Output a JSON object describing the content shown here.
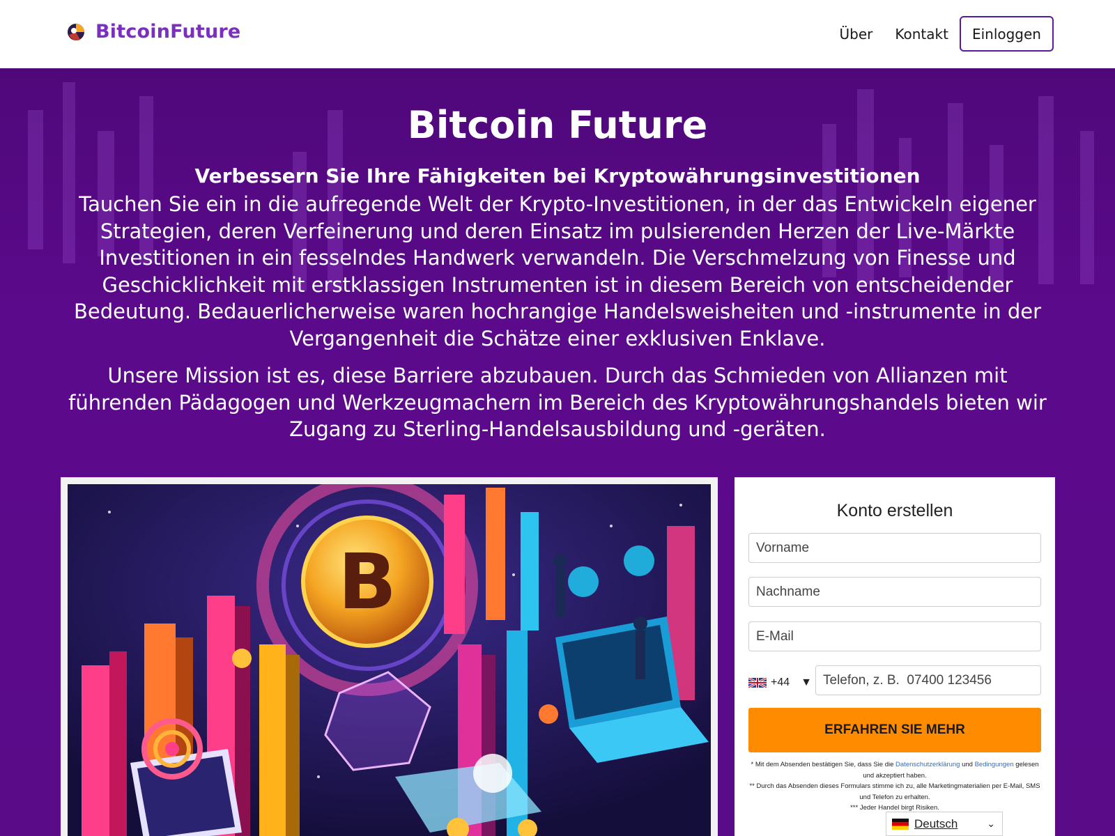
{
  "header": {
    "brand": "BitcoinFuture",
    "nav": [
      {
        "label": "Über"
      },
      {
        "label": "Kontakt"
      }
    ],
    "login_label": "Einloggen"
  },
  "hero": {
    "title": "Bitcoin Future",
    "subtitle": "Verbessern Sie Ihre Fähigkeiten bei Kryptowährungsinvestitionen",
    "paragraph1": "Tauchen Sie ein in die aufregende Welt der Krypto-Investitionen, in der das Entwickeln eigener Strategien, deren Verfeinerung und deren Einsatz im pulsierenden Herzen der Live-Märkte Investitionen in ein fesselndes Handwerk verwandeln. Die Verschmelzung von Finesse und Geschicklichkeit mit erstklassigen Instrumenten ist in diesem Bereich von entscheidender Bedeutung. Bedauerlicherweise waren hochrangige Handelsweisheiten und -instrumente in der Vergangenheit die Schätze einer exklusiven Enklave.",
    "paragraph2": "Unsere Mission ist es, diese Barriere abzubauen. Durch das Schmieden von Allianzen mit führenden Pädagogen und Werkzeugmachern im Bereich des Kryptowährungshandels bieten wir Zugang zu Sterling-Handelsausbildung und -geräten."
  },
  "form": {
    "title": "Konto erstellen",
    "first_name_placeholder": "Vorname",
    "last_name_placeholder": "Nachname",
    "email_placeholder": "E-Mail",
    "country_code": "+44",
    "phone_placeholder": "Telefon, z. B.  07400 123456",
    "submit_label": "ERFAHREN SIE MEHR",
    "disclaimer": {
      "line1_before": "* Mit dem Absenden bestätigen Sie, dass Sie die ",
      "privacy_link": "Datenschutzerklärung",
      "line1_and": " und ",
      "terms_link": "Bedingungen",
      "line1_after": " gelesen und akzeptiert haben.",
      "line2": "** Durch das Absenden dieses Formulars stimme ich zu, alle Marketingmaterialien per E-Mail, SMS und Telefon zu erhalten.",
      "line3": "*** Jeder Handel birgt Risiken."
    },
    "language": "Deutsch"
  },
  "colors": {
    "brand_purple": "#7b2fbf",
    "hero_bg": "#5a0b88",
    "cta_orange": "#ff8c00",
    "link_blue": "#2a6ecb"
  },
  "icons": {
    "brand_logo": "crypto-globe-icon",
    "country_flag": "uk-flag-icon",
    "language_flag": "german-flag-icon"
  }
}
